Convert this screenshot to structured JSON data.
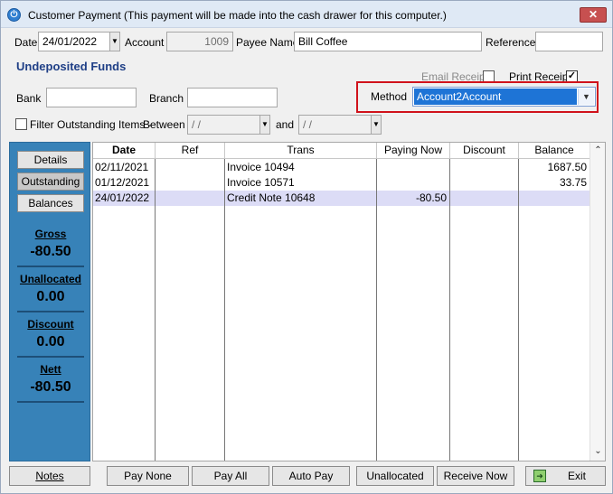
{
  "window": {
    "title": "Customer Payment (This payment will be made into the cash drawer for this computer.)",
    "close_glyph": "✕"
  },
  "header": {
    "date_label": "Date",
    "date_value": "24/01/2022",
    "account_label": "Account",
    "account_value": "1009",
    "payee_label": "Payee Name",
    "payee_value": "Bill Coffee",
    "reference_label": "Reference",
    "reference_value": ""
  },
  "section_title": "Undeposited Funds",
  "receipts": {
    "email_label": "Email Receipt",
    "email_checked": false,
    "print_label": "Print Receipt",
    "print_checked": true
  },
  "bank": {
    "bank_label": "Bank",
    "bank_value": "",
    "branch_label": "Branch",
    "branch_value": ""
  },
  "method": {
    "label": "Method",
    "value": "Account2Account"
  },
  "filter": {
    "label": "Filter Outstanding Items -",
    "between_label": "Between",
    "from_value": " / /",
    "and_label": "and",
    "to_value": " / /"
  },
  "side": {
    "buttons": [
      "Details",
      "Outstanding",
      "Balances"
    ],
    "gross_label": "Gross",
    "gross_value": "-80.50",
    "unallocated_label": "Unallocated",
    "unallocated_value": "0.00",
    "discount_label": "Discount",
    "discount_value": "0.00",
    "nett_label": "Nett",
    "nett_value": "-80.50"
  },
  "grid": {
    "columns": [
      "Date",
      "Ref",
      "Trans",
      "Paying Now",
      "Discount",
      "Balance"
    ],
    "rows": [
      {
        "date": "02/11/2021",
        "ref": "",
        "trans": "Invoice 10494",
        "paying": "",
        "discount": "",
        "balance": "1687.50"
      },
      {
        "date": "01/12/2021",
        "ref": "",
        "trans": "Invoice 10571",
        "paying": "",
        "discount": "",
        "balance": "33.75"
      },
      {
        "date": "24/01/2022",
        "ref": "",
        "trans": "Credit Note 10648",
        "paying": "-80.50",
        "discount": "",
        "balance": ""
      }
    ],
    "scroll_up": "⌃",
    "scroll_down": "⌄"
  },
  "footer": {
    "notes": "Notes",
    "pay_none": "Pay None",
    "pay_all": "Pay All",
    "auto_pay": "Auto Pay",
    "unallocated": "Unallocated",
    "receive_now": "Receive Now",
    "exit": "Exit"
  }
}
